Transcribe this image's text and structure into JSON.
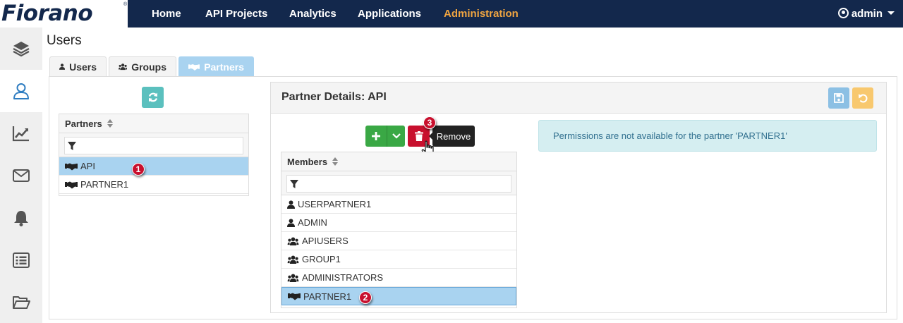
{
  "app": {
    "logo_text": "Fiorano",
    "logo_mark": "®"
  },
  "nav": {
    "items": [
      {
        "label": "Home"
      },
      {
        "label": "API Projects"
      },
      {
        "label": "Analytics"
      },
      {
        "label": "Applications"
      },
      {
        "label": "Administration",
        "active": true
      }
    ],
    "user": "admin"
  },
  "sidebar": {
    "items": [
      {
        "icon": "layers-icon"
      },
      {
        "icon": "user-icon",
        "active": true
      },
      {
        "icon": "chart-area-icon"
      },
      {
        "icon": "envelope-icon"
      },
      {
        "icon": "bell-icon"
      },
      {
        "icon": "list-icon"
      },
      {
        "icon": "folder-open-icon"
      }
    ]
  },
  "page": {
    "title": "Users"
  },
  "tabs": [
    {
      "label": "Users",
      "icon": "user-icon"
    },
    {
      "label": "Groups",
      "icon": "users-icon"
    },
    {
      "label": "Partners",
      "icon": "handshake-icon",
      "active": true
    }
  ],
  "partners": {
    "header": "Partners",
    "filter_placeholder": "",
    "rows": [
      {
        "label": "API",
        "selected": true
      },
      {
        "label": "PARTNER1"
      }
    ]
  },
  "details": {
    "title": "Partner Details: API",
    "tooltip": "Remove",
    "alert": "Permissions are not available for the partner 'PARTNER1'",
    "members": {
      "header": "Members",
      "filter_placeholder": "",
      "rows": [
        {
          "label": "USERPARTNER1",
          "icon": "user-icon"
        },
        {
          "label": "ADMIN",
          "icon": "user-icon"
        },
        {
          "label": "APIUSERS",
          "icon": "users-icon"
        },
        {
          "label": "GROUP1",
          "icon": "users-icon"
        },
        {
          "label": "ADMINISTRATORS",
          "icon": "users-icon"
        },
        {
          "label": "PARTNER1",
          "icon": "handshake-icon",
          "selected": true
        }
      ]
    }
  },
  "annotations": [
    "1",
    "2",
    "3"
  ],
  "colors": {
    "navbar": "#13284c",
    "accent": "#f0a541",
    "selected": "#a9d3f0",
    "add": "#3aa845",
    "remove": "#c8102e",
    "refresh": "#5bc0be",
    "save": "#8cc0e4",
    "undo": "#f8c86e"
  }
}
